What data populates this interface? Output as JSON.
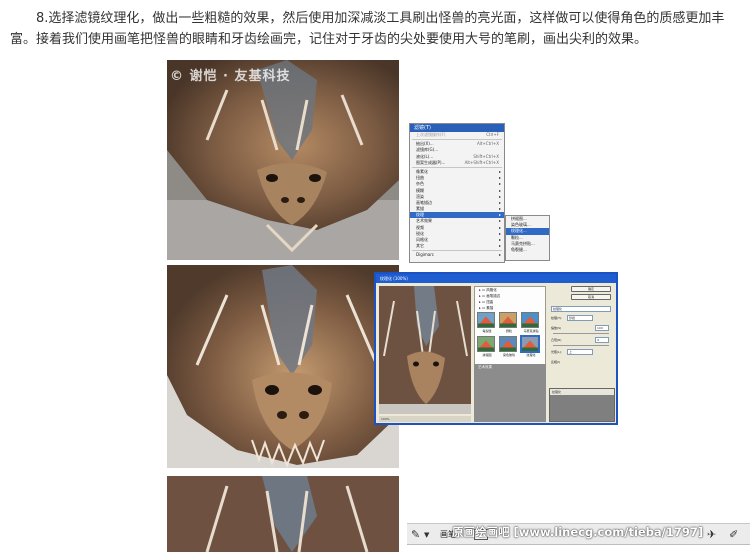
{
  "paragraph": "8.选择滤镜纹理化，做出一些粗糙的效果，然后使用加深减淡工具刷出怪兽的亮光面，这样做可以使得角色的质感更加丰富。接着我们使用画笔把怪兽的眼睛和牙齿绘画完，记住对于牙齿的尖处要使用大号的笔刷，画出尖利的效果。",
  "watermark_top": "© 谢恺 · 友基科技",
  "watermark_bottom": "原画绘画吧 [www.linecg.com/tieba/1797]",
  "filter_menu": {
    "title": "滤镜(T)",
    "items": [
      {
        "label": "上次滤镜操作(F)",
        "shortcut": "Ctrl+F",
        "disabled": true
      },
      {
        "sep": true
      },
      {
        "label": "抽出(X)...",
        "shortcut": "Alt+Ctrl+X"
      },
      {
        "label": "滤镜库(G)..."
      },
      {
        "label": "液化(L)...",
        "shortcut": "Shift+Ctrl+X"
      },
      {
        "label": "图案生成器(P)...",
        "shortcut": "Alt+Shift+Ctrl+X"
      },
      {
        "sep": true
      },
      {
        "label": "像素化",
        "arrow": true
      },
      {
        "label": "扭曲",
        "arrow": true
      },
      {
        "label": "杂色",
        "arrow": true
      },
      {
        "label": "模糊",
        "arrow": true
      },
      {
        "label": "渲染",
        "arrow": true
      },
      {
        "label": "画笔描边",
        "arrow": true
      },
      {
        "label": "素描",
        "arrow": true
      },
      {
        "label": "纹理",
        "arrow": true,
        "highlighted": true
      },
      {
        "label": "艺术效果",
        "arrow": true
      },
      {
        "label": "视频",
        "arrow": true
      },
      {
        "label": "锐化",
        "arrow": true
      },
      {
        "label": "风格化",
        "arrow": true
      },
      {
        "label": "其它",
        "arrow": true
      },
      {
        "sep": true
      },
      {
        "label": "Digimarc",
        "arrow": true
      }
    ]
  },
  "submenu": {
    "items": [
      {
        "label": "拼缀图..."
      },
      {
        "label": "染色玻璃..."
      },
      {
        "label": "纹理化...",
        "highlighted": true
      },
      {
        "label": "颗粒..."
      },
      {
        "label": "马赛克拼贴..."
      },
      {
        "label": "龟裂缝..."
      }
    ]
  },
  "filter_gallery": {
    "title": "纹理化 (100%)",
    "folders": [
      "风格化",
      "画笔描边",
      "扭曲",
      "素描",
      "纹理"
    ],
    "thumbs": [
      "龟裂缝",
      "颗粒",
      "马赛克拼贴",
      "拼缀图",
      "染色玻璃",
      "纹理化"
    ],
    "bottom_folder": "艺术效果",
    "buttons": [
      "确定",
      "取消"
    ],
    "dropdown": "纹理化",
    "fields": {
      "texture_label": "纹理(T):",
      "texture_value": "砂岩",
      "scale_label": "缩放(S)",
      "scale_value": "100",
      "relief_label": "凸现(R)",
      "relief_value": "4",
      "light_label": "光照(L):",
      "light_value": "上"
    },
    "invert": "反相(I)",
    "layer_row": "纹理化",
    "zoom": "100%"
  },
  "toolbar": {
    "brush_label": "画笔:",
    "icons": [
      "brush-tool-icon",
      "dropdown-arrow-icon",
      "airbrush-icon",
      "pen-tablet-icon"
    ]
  },
  "colors": {
    "menu_highlight": "#316ac5",
    "dialog_border": "#1d52c2",
    "dragon_dark": "#5b4332",
    "dragon_light": "#c6a583"
  }
}
